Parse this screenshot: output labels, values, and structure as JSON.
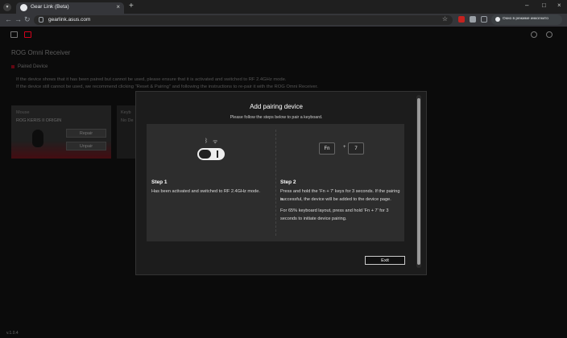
{
  "browser": {
    "tab_title": "Gear Link (Beta)",
    "url": "gearlink.asus.com",
    "incognito_label": "Окно в режиме инкогнито"
  },
  "app": {
    "page_title": "ROG Omni Receiver",
    "section_title": "Paired Device",
    "info_lines": [
      "If the device shows that it has been paired but cannot be used, please ensure that it is activated and switched to RF 2.4GHz mode.",
      "If the device still cannot be used, we recommend clicking \"Reset & Pairing\" and following the instructions to re-pair it with the ROG Omni Receiver."
    ],
    "device_card": {
      "category": "Mouse",
      "name": "ROG KERIS II ORIGIN",
      "repair_label": "Repair",
      "unpair_label": "Unpair"
    },
    "second_card": {
      "category": "Keyb",
      "status": "No De"
    },
    "version": "v.1.0.4"
  },
  "modal": {
    "title": "Add pairing device",
    "subtitle": "Please follow the steps below to pair a keyboard.",
    "step1": {
      "title": "Step 1",
      "text": "Has been activated and switched to RF 2.4GHz mode."
    },
    "step2": {
      "title": "Step 2",
      "keys": [
        "Fn",
        "7"
      ],
      "plus": "+",
      "text1_lines": [
        "Press and hold the 'Fn + 7' keys for 3 seconds. If the pairing is",
        "successful, the device will be added to the device page."
      ],
      "text2_lines": [
        "For 65% keyboard layout, press and hold 'Fn + 7' for 3",
        "seconds to initiate device pairing."
      ]
    },
    "exit_label": "Exit"
  }
}
